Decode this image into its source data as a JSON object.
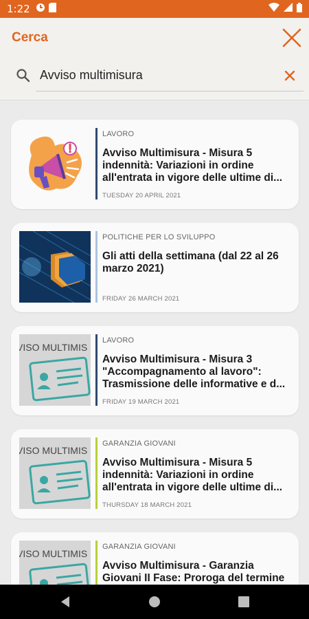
{
  "status_bar": {
    "time": "1:22"
  },
  "header": {
    "title": "Cerca"
  },
  "search": {
    "value": "Avviso multimisura"
  },
  "results": [
    {
      "category": "LAVORO",
      "title": "Avviso Multimisura - Misura 5 indennità: Variazioni in ordine all'entrata in vigore delle ultime di...",
      "date": "TUESDAY 20 APRIL 2021",
      "accent_color": "#2f4a6d",
      "thumb": "megaphone-illustration"
    },
    {
      "category": "POLITICHE PER LO SVILUPPO",
      "title": "Gli atti della settimana (dal 22 al 26 marzo 2021)",
      "date": "FRIDAY 26 MARCH 2021",
      "accent_color": "#a9c4df",
      "thumb": "folders-photo"
    },
    {
      "category": "LAVORO",
      "title": "Avviso Multimisura - Misura 3 \"Accompagnamento al lavoro\": Trasmissione delle informative e d...",
      "date": "FRIDAY 19 MARCH 2021",
      "accent_color": "#2f4a6d",
      "thumb": "multimisura-card"
    },
    {
      "category": "GARANZIA GIOVANI",
      "title": "Avviso Multimisura - Misura 5 indennità: Variazioni in ordine all'entrata in vigore delle ultime di...",
      "date": "THURSDAY 18 MARCH 2021",
      "accent_color": "#b9cf3b",
      "thumb": "multimisura-card"
    },
    {
      "category": "GARANZIA GIOVANI",
      "title": "Avviso Multimisura - Garanzia Giovani II Fase: Proroga del termine",
      "date": "",
      "accent_color": "#b9cf3b",
      "thumb": "multimisura-card"
    }
  ],
  "thumb_caption": "VISO MULTIMIS",
  "colors": {
    "brand": "#e0651f",
    "background": "#ebebeb",
    "card": "#fafafa"
  }
}
